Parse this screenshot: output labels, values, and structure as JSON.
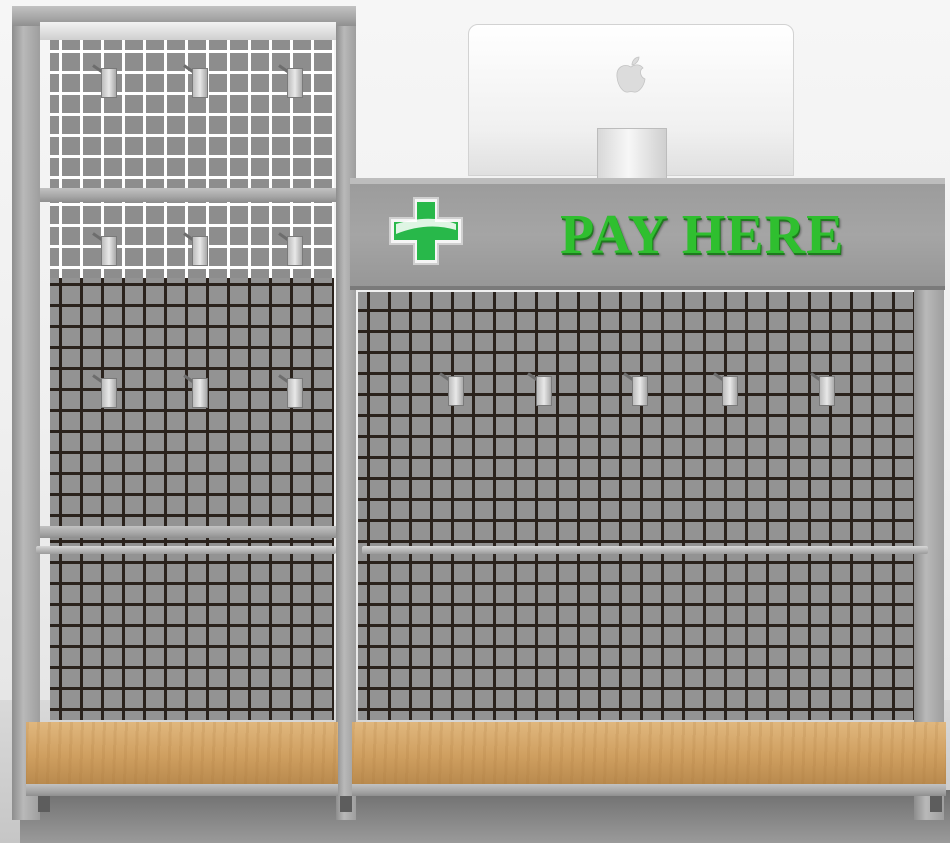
{
  "sign": {
    "text": "PAY HERE",
    "text_color": "#2fbf2f"
  },
  "icons": {
    "cross": "green-cross-icon",
    "monitor_logo": "apple-logo-icon"
  },
  "colors": {
    "metal": "#9a9a9a",
    "wood": "#d2a466",
    "wall": "#f2f2f2"
  }
}
